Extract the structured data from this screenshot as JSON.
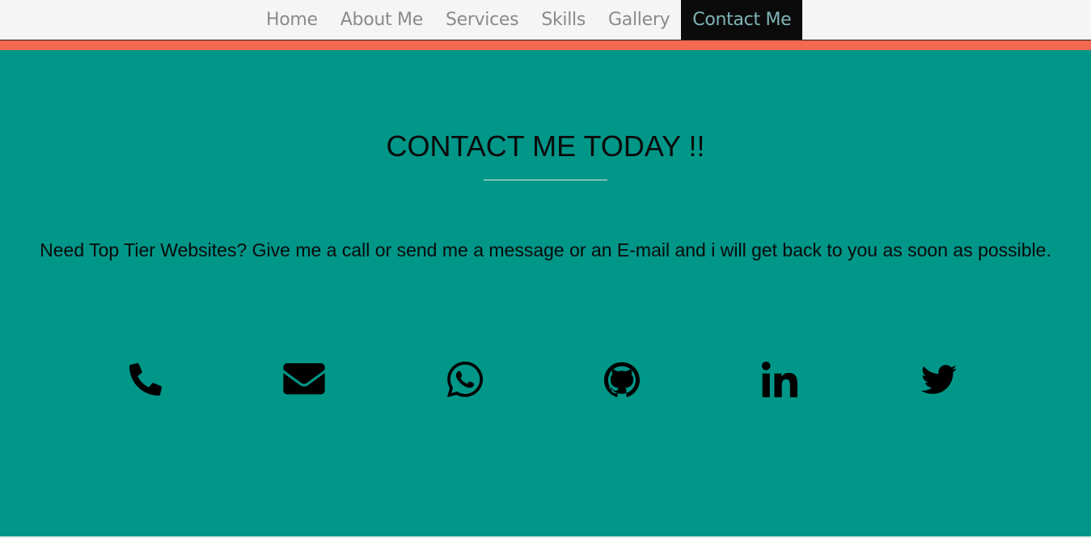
{
  "nav": {
    "items": [
      {
        "label": "Home",
        "active": false
      },
      {
        "label": "About Me",
        "active": false
      },
      {
        "label": "Services",
        "active": false
      },
      {
        "label": "Skills",
        "active": false
      },
      {
        "label": "Gallery",
        "active": false
      },
      {
        "label": "Contact Me",
        "active": true
      }
    ]
  },
  "contact": {
    "title": "CONTACT ME TODAY !!",
    "message": "Need Top Tier Websites? Give me a call or send me a message or an E-mail and i will get back to you as soon as possible.",
    "icons": [
      {
        "name": "phone-icon"
      },
      {
        "name": "envelope-icon"
      },
      {
        "name": "whatsapp-icon"
      },
      {
        "name": "github-icon"
      },
      {
        "name": "linkedin-icon"
      },
      {
        "name": "twitter-icon"
      }
    ]
  },
  "colors": {
    "nav_bg": "#f5f5f5",
    "nav_text": "#8a8a8a",
    "nav_active_bg": "#0b0b0b",
    "nav_active_text": "#7fb3b6",
    "accent": "#f26a4f",
    "section_bg": "#009688",
    "text": "#0a0a0a"
  }
}
